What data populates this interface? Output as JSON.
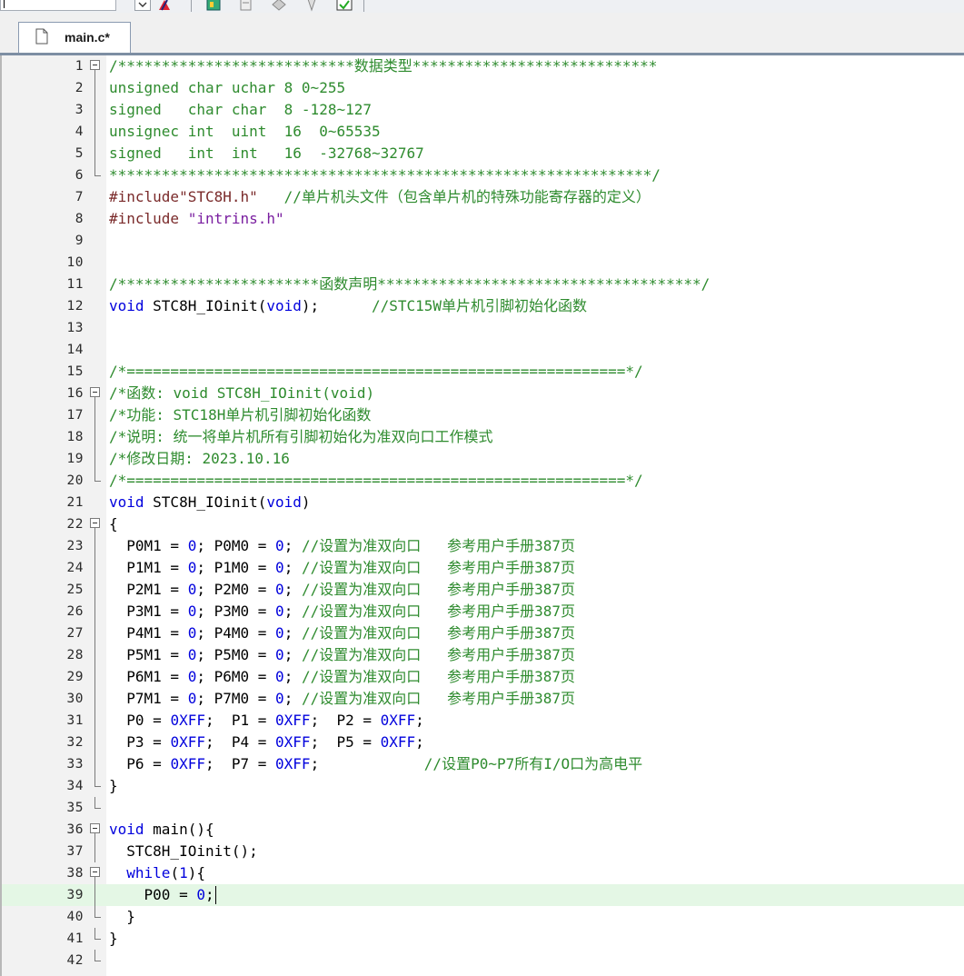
{
  "tab": {
    "label": "main.c*"
  },
  "colors": {
    "comment": "#2e8b2e",
    "keyword": "#0000dd",
    "number": "#0000dd",
    "preprocessor": "#7a2a2a",
    "string": "#7a1fa0",
    "current_line_bg": "#e4f7e5"
  },
  "editor": {
    "current_line": 39,
    "lines": [
      {
        "n": "1",
        "fold": "open",
        "tokens": [
          [
            "cmt",
            "/***************************数据类型****************************"
          ]
        ]
      },
      {
        "n": "2",
        "fold": "line",
        "tokens": [
          [
            "cmt",
            "unsigned char uchar 8 0~255"
          ]
        ]
      },
      {
        "n": "3",
        "fold": "line",
        "tokens": [
          [
            "cmt",
            "signed   char char  8 -128~127"
          ]
        ]
      },
      {
        "n": "4",
        "fold": "line",
        "tokens": [
          [
            "cmt",
            "unsignec int  uint  16  0~65535"
          ]
        ]
      },
      {
        "n": "5",
        "fold": "line",
        "tokens": [
          [
            "cmt",
            "signed   int  int   16  -32768~32767"
          ]
        ]
      },
      {
        "n": "6",
        "fold": "end",
        "tokens": [
          [
            "cmt",
            "**************************************************************/"
          ]
        ]
      },
      {
        "n": "7",
        "fold": "none",
        "tokens": [
          [
            "pp",
            "#include\"STC8H.h\"   "
          ],
          [
            "cmt",
            "//单片机头文件（包含单片机的特殊功能寄存器的定义）"
          ]
        ]
      },
      {
        "n": "8",
        "fold": "none",
        "tokens": [
          [
            "pp",
            "#include "
          ],
          [
            "str",
            "\"intrins.h\""
          ]
        ]
      },
      {
        "n": "9",
        "fold": "none",
        "tokens": []
      },
      {
        "n": "10",
        "fold": "none",
        "tokens": []
      },
      {
        "n": "11",
        "fold": "none",
        "tokens": [
          [
            "cmt",
            "/***********************函数声明*************************************/"
          ]
        ]
      },
      {
        "n": "12",
        "fold": "none",
        "tokens": [
          [
            "kw",
            "void"
          ],
          [
            "id",
            " STC8H_IOinit("
          ],
          [
            "kw",
            "void"
          ],
          [
            "id",
            ");      "
          ],
          [
            "cmt",
            "//STC15W单片机引脚初始化函数"
          ]
        ]
      },
      {
        "n": "13",
        "fold": "none",
        "tokens": []
      },
      {
        "n": "14",
        "fold": "none",
        "tokens": []
      },
      {
        "n": "15",
        "fold": "none",
        "tokens": [
          [
            "cmt",
            "/*=========================================================*/"
          ]
        ]
      },
      {
        "n": "16",
        "fold": "open",
        "tokens": [
          [
            "cmt",
            "/*函数: void STC8H_IOinit(void)"
          ]
        ]
      },
      {
        "n": "17",
        "fold": "line",
        "tokens": [
          [
            "cmt",
            "/*功能: STC18H单片机引脚初始化函数"
          ]
        ]
      },
      {
        "n": "18",
        "fold": "line",
        "tokens": [
          [
            "cmt",
            "/*说明: 统一将单片机所有引脚初始化为准双向口工作模式"
          ]
        ]
      },
      {
        "n": "19",
        "fold": "line",
        "tokens": [
          [
            "cmt",
            "/*修改日期: 2023.10.16"
          ]
        ]
      },
      {
        "n": "20",
        "fold": "end",
        "tokens": [
          [
            "cmt",
            "/*=========================================================*/"
          ]
        ]
      },
      {
        "n": "21",
        "fold": "none",
        "tokens": [
          [
            "kw",
            "void"
          ],
          [
            "id",
            " STC8H_IOinit("
          ],
          [
            "kw",
            "void"
          ],
          [
            "id",
            ")"
          ]
        ]
      },
      {
        "n": "22",
        "fold": "open",
        "tokens": [
          [
            "id",
            "{"
          ]
        ]
      },
      {
        "n": "23",
        "fold": "line",
        "tokens": [
          [
            "id",
            "  P0M1 = "
          ],
          [
            "num",
            "0"
          ],
          [
            "id",
            "; P0M0 = "
          ],
          [
            "num",
            "0"
          ],
          [
            "id",
            "; "
          ],
          [
            "cmt",
            "//设置为准双向口   参考用户手册387页"
          ]
        ]
      },
      {
        "n": "24",
        "fold": "line",
        "tokens": [
          [
            "id",
            "  P1M1 = "
          ],
          [
            "num",
            "0"
          ],
          [
            "id",
            "; P1M0 = "
          ],
          [
            "num",
            "0"
          ],
          [
            "id",
            "; "
          ],
          [
            "cmt",
            "//设置为准双向口   参考用户手册387页"
          ]
        ]
      },
      {
        "n": "25",
        "fold": "line",
        "tokens": [
          [
            "id",
            "  P2M1 = "
          ],
          [
            "num",
            "0"
          ],
          [
            "id",
            "; P2M0 = "
          ],
          [
            "num",
            "0"
          ],
          [
            "id",
            "; "
          ],
          [
            "cmt",
            "//设置为准双向口   参考用户手册387页"
          ]
        ]
      },
      {
        "n": "26",
        "fold": "line",
        "tokens": [
          [
            "id",
            "  P3M1 = "
          ],
          [
            "num",
            "0"
          ],
          [
            "id",
            "; P3M0 = "
          ],
          [
            "num",
            "0"
          ],
          [
            "id",
            "; "
          ],
          [
            "cmt",
            "//设置为准双向口   参考用户手册387页"
          ]
        ]
      },
      {
        "n": "27",
        "fold": "line",
        "tokens": [
          [
            "id",
            "  P4M1 = "
          ],
          [
            "num",
            "0"
          ],
          [
            "id",
            "; P4M0 = "
          ],
          [
            "num",
            "0"
          ],
          [
            "id",
            "; "
          ],
          [
            "cmt",
            "//设置为准双向口   参考用户手册387页"
          ]
        ]
      },
      {
        "n": "28",
        "fold": "line",
        "tokens": [
          [
            "id",
            "  P5M1 = "
          ],
          [
            "num",
            "0"
          ],
          [
            "id",
            "; P5M0 = "
          ],
          [
            "num",
            "0"
          ],
          [
            "id",
            "; "
          ],
          [
            "cmt",
            "//设置为准双向口   参考用户手册387页"
          ]
        ]
      },
      {
        "n": "29",
        "fold": "line",
        "tokens": [
          [
            "id",
            "  P6M1 = "
          ],
          [
            "num",
            "0"
          ],
          [
            "id",
            "; P6M0 = "
          ],
          [
            "num",
            "0"
          ],
          [
            "id",
            "; "
          ],
          [
            "cmt",
            "//设置为准双向口   参考用户手册387页"
          ]
        ]
      },
      {
        "n": "30",
        "fold": "line",
        "tokens": [
          [
            "id",
            "  P7M1 = "
          ],
          [
            "num",
            "0"
          ],
          [
            "id",
            "; P7M0 = "
          ],
          [
            "num",
            "0"
          ],
          [
            "id",
            "; "
          ],
          [
            "cmt",
            "//设置为准双向口   参考用户手册387页"
          ]
        ]
      },
      {
        "n": "31",
        "fold": "line",
        "tokens": [
          [
            "id",
            "  P0 = "
          ],
          [
            "num",
            "0XFF"
          ],
          [
            "id",
            ";  P1 = "
          ],
          [
            "num",
            "0XFF"
          ],
          [
            "id",
            ";  P2 = "
          ],
          [
            "num",
            "0XFF"
          ],
          [
            "id",
            ";"
          ]
        ]
      },
      {
        "n": "32",
        "fold": "line",
        "tokens": [
          [
            "id",
            "  P3 = "
          ],
          [
            "num",
            "0XFF"
          ],
          [
            "id",
            ";  P4 = "
          ],
          [
            "num",
            "0XFF"
          ],
          [
            "id",
            ";  P5 = "
          ],
          [
            "num",
            "0XFF"
          ],
          [
            "id",
            ";"
          ]
        ]
      },
      {
        "n": "33",
        "fold": "line",
        "tokens": [
          [
            "id",
            "  P6 = "
          ],
          [
            "num",
            "0XFF"
          ],
          [
            "id",
            ";  P7 = "
          ],
          [
            "num",
            "0XFF"
          ],
          [
            "id",
            ";            "
          ],
          [
            "cmt",
            "//设置P0~P7所有I/O口为高电平"
          ]
        ]
      },
      {
        "n": "34",
        "fold": "end",
        "tokens": [
          [
            "id",
            "}"
          ]
        ]
      },
      {
        "n": "35",
        "fold": "end",
        "tokens": []
      },
      {
        "n": "36",
        "fold": "open",
        "tokens": [
          [
            "kw",
            "void"
          ],
          [
            "id",
            " main(){"
          ]
        ]
      },
      {
        "n": "37",
        "fold": "line",
        "tokens": [
          [
            "id",
            "  STC8H_IOinit();"
          ]
        ]
      },
      {
        "n": "38",
        "fold": "open",
        "tokens": [
          [
            "id",
            "  "
          ],
          [
            "kw",
            "while"
          ],
          [
            "id",
            "("
          ],
          [
            "num",
            "1"
          ],
          [
            "id",
            "){"
          ]
        ]
      },
      {
        "n": "39",
        "fold": "line",
        "tokens": [
          [
            "id",
            "    P00 = "
          ],
          [
            "num",
            "0"
          ],
          [
            "id",
            ";"
          ]
        ]
      },
      {
        "n": "40",
        "fold": "end",
        "tokens": [
          [
            "id",
            "  }"
          ]
        ]
      },
      {
        "n": "41",
        "fold": "end",
        "tokens": [
          [
            "id",
            "}"
          ]
        ]
      },
      {
        "n": "42",
        "fold": "end",
        "tokens": []
      }
    ]
  }
}
